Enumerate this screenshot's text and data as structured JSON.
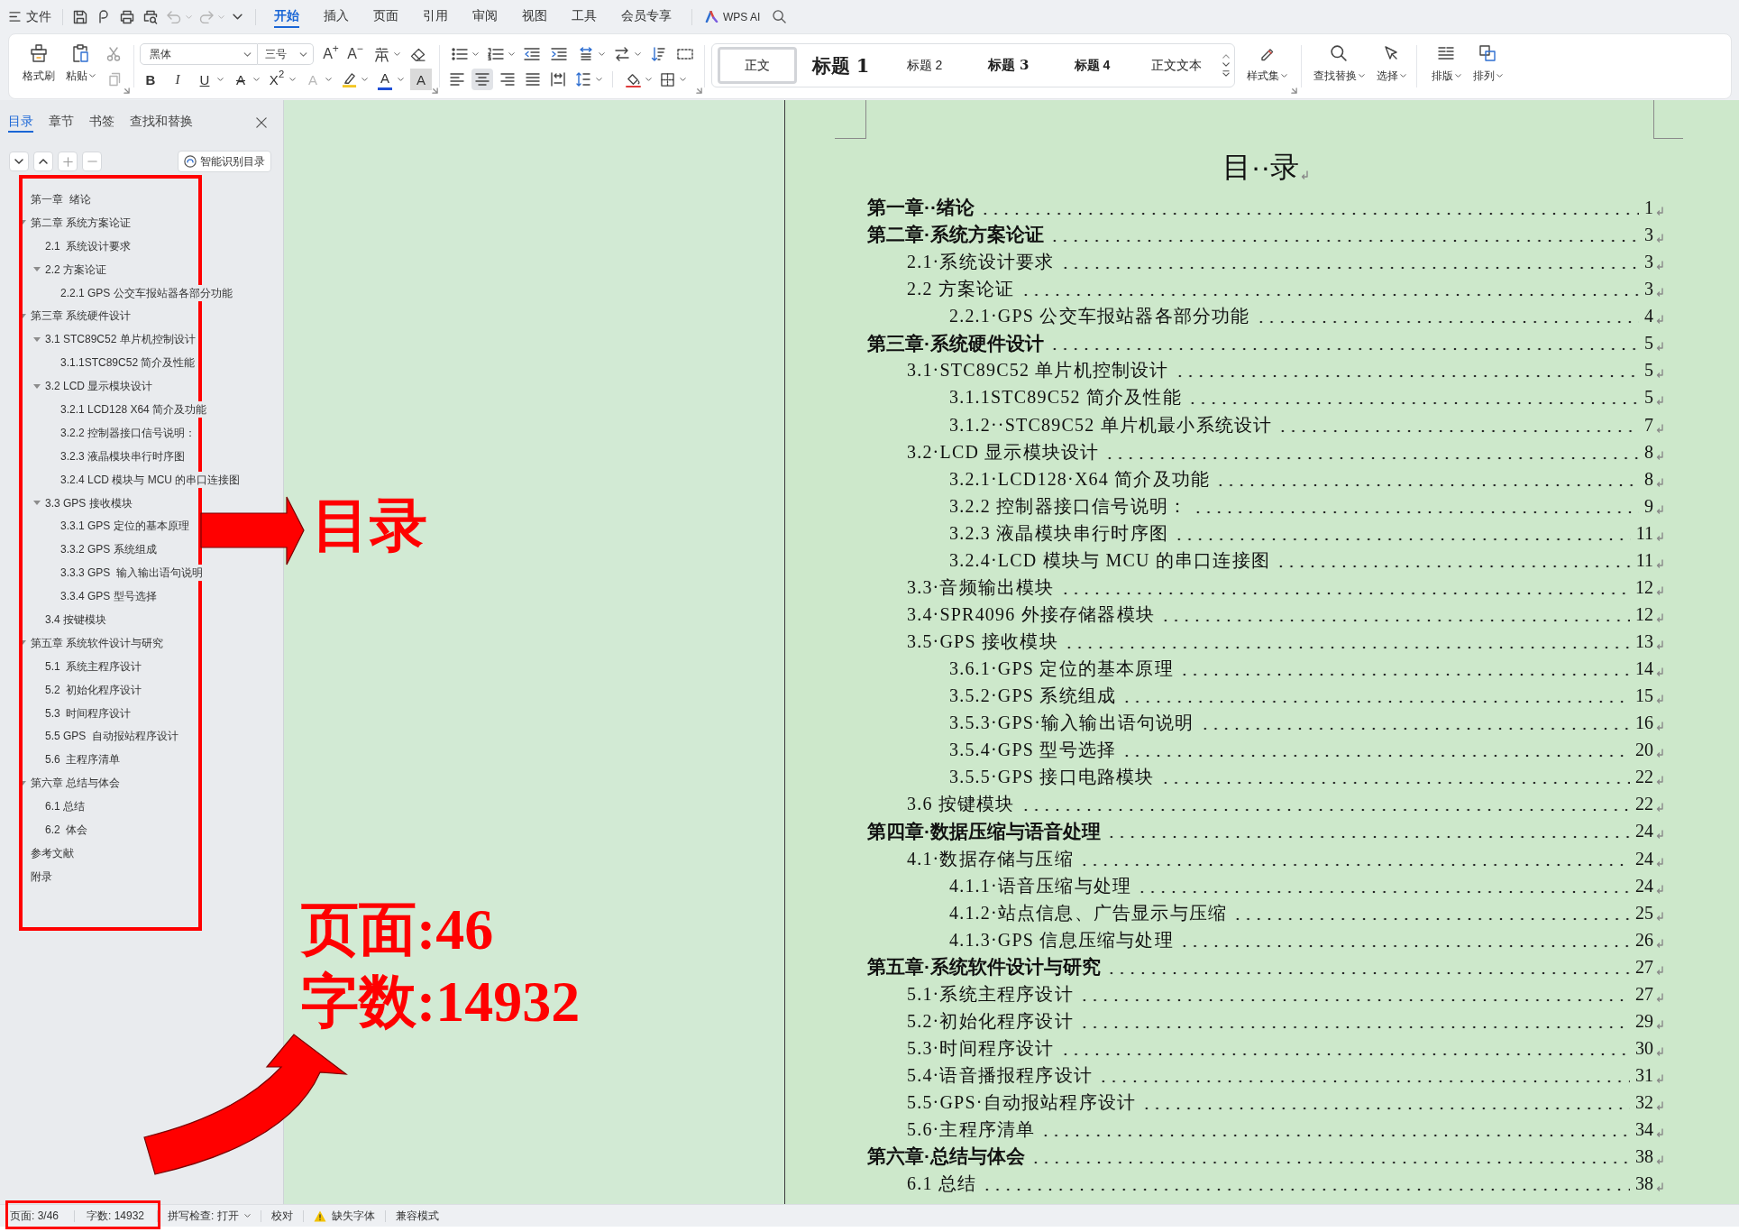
{
  "menu_bar": {
    "file_menu": "文件",
    "tabs": [
      {
        "label": "开始",
        "selected": true
      },
      {
        "label": "插入",
        "selected": false
      },
      {
        "label": "页面",
        "selected": false
      },
      {
        "label": "引用",
        "selected": false
      },
      {
        "label": "审阅",
        "selected": false
      },
      {
        "label": "视图",
        "selected": false
      },
      {
        "label": "工具",
        "selected": false
      },
      {
        "label": "会员专享",
        "selected": false
      }
    ],
    "ai_button": "WPS AI"
  },
  "ribbon": {
    "format_painter": "格式刷",
    "paste": "粘贴",
    "font_name": "黑体",
    "font_size": "三号",
    "size_buttons": [
      "A$^{+}$",
      "A$^{−}$"
    ],
    "format_buttons": [
      {
        "kind": "bold",
        "label": "B"
      },
      {
        "kind": "italic",
        "label": "I"
      },
      {
        "kind": "underline",
        "label": "U"
      },
      {
        "kind": "strikethrough",
        "label": "A"
      },
      {
        "kind": "superscript",
        "label": "X$^{2}$"
      },
      {
        "kind": "effect",
        "label": "A"
      },
      {
        "kind": "color",
        "label": "A"
      },
      {
        "kind": "shading",
        "label": "A"
      }
    ],
    "alignment": [
      {
        "kind": "left",
        "selected": false
      },
      {
        "kind": "center",
        "selected": true
      },
      {
        "kind": "right",
        "selected": false
      },
      {
        "kind": "justify",
        "selected": false
      },
      {
        "kind": "distributed",
        "selected": false
      }
    ],
    "styles": [
      {
        "kind": "body",
        "label": "正文",
        "selected": true
      },
      {
        "kind": "heading1",
        "label": "标题 1",
        "selected": false
      },
      {
        "kind": "heading2",
        "label": "标题 2",
        "selected": false
      },
      {
        "kind": "heading3",
        "label": "标题 3",
        "selected": false
      },
      {
        "kind": "heading4",
        "label": "标题 4",
        "selected": false
      },
      {
        "kind": "body_text",
        "label": "正文文本",
        "selected": false
      }
    ],
    "style_set": "样式集",
    "find_replace": "查找替换",
    "select": "选择",
    "layout": "排版",
    "arrange": "排列"
  },
  "sidebar": {
    "tabs": [
      {
        "label": "目录",
        "selected": true
      },
      {
        "label": "章节",
        "selected": false
      },
      {
        "label": "书签",
        "selected": false
      },
      {
        "label": "查找和替换",
        "selected": false
      }
    ],
    "smart_toc_button": "智能识别目录",
    "outline": [
      {
        "text": "第一章  绪论"
      },
      {
        "text": "第二章 系统方案论证",
        "expanded": true,
        "children": [
          {
            "text": "2.1  系统设计要求"
          },
          {
            "text": "2.2 方案论证",
            "expanded": true,
            "children": [
              {
                "text": "2.2.1 GPS 公交车报站器各部分功能"
              }
            ]
          }
        ]
      },
      {
        "text": "第三章 系统硬件设计",
        "expanded": true,
        "children": [
          {
            "text": "3.1 STC89C52 单片机控制设计",
            "expanded": true,
            "children": [
              {
                "text": "3.1.1STC89C52 简介及性能"
              }
            ]
          },
          {
            "text": "3.2 LCD 显示模块设计",
            "expanded": true,
            "children": [
              {
                "text": "3.2.1 LCD128 X64 简介及功能"
              },
              {
                "text": "3.2.2 控制器接口信号说明："
              },
              {
                "text": "3.2.3 液晶模块串行时序图"
              },
              {
                "text": "3.2.4 LCD 模块与 MCU 的串口连接图"
              }
            ]
          },
          {
            "text": "3.3 GPS 接收模块",
            "expanded": true,
            "children": [
              {
                "text": "3.3.1 GPS 定位的基本原理"
              },
              {
                "text": "3.3.2 GPS 系统组成"
              },
              {
                "text": "3.3.3 GPS  输入输出语句说明"
              },
              {
                "text": "3.3.4 GPS 型号选择"
              }
            ]
          },
          {
            "text": "3.4 按键模块"
          }
        ]
      },
      {
        "text": "第五章 系统软件设计与研究",
        "expanded": true,
        "children": [
          {
            "text": "5.1  系统主程序设计"
          },
          {
            "text": "5.2  初始化程序设计"
          },
          {
            "text": "5.3  时间程序设计"
          },
          {
            "text": "5.5 GPS  自动报站程序设计"
          },
          {
            "text": "5.6  主程序清单"
          }
        ]
      },
      {
        "text": "第六章 总结与体会",
        "expanded": true,
        "children": [
          {
            "text": "6.1 总结"
          },
          {
            "text": "6.2  体会"
          }
        ]
      },
      {
        "text": "参考文献"
      },
      {
        "text": "附录"
      }
    ]
  },
  "document": {
    "title": "目··录",
    "toc": [
      {
        "text": "第一章··绪论",
        "page": "1"
      },
      {
        "text": "第二章·系统方案论证",
        "page": "3",
        "children": [
          {
            "text": "2.1·系统设计要求",
            "page": "3"
          },
          {
            "text": "2.2 方案论证",
            "page": "3",
            "children": [
              {
                "text": "2.2.1·GPS 公交车报站器各部分功能",
                "page": "4"
              }
            ]
          }
        ]
      },
      {
        "text": "第三章·系统硬件设计",
        "page": "5",
        "children": [
          {
            "text": "3.1·STC89C52 单片机控制设计",
            "page": "5",
            "children": [
              {
                "text": "3.1.1STC89C52 简介及性能",
                "page": "5"
              },
              {
                "text": "3.1.2··STC89C52 单片机最小系统设计",
                "page": "7"
              }
            ]
          },
          {
            "text": "3.2·LCD 显示模块设计",
            "page": "8",
            "children": [
              {
                "text": "3.2.1·LCD128·X64 简介及功能",
                "page": "8"
              },
              {
                "text": "3.2.2 控制器接口信号说明：",
                "page": "9"
              },
              {
                "text": "3.2.3 液晶模块串行时序图",
                "page": "11"
              },
              {
                "text": "3.2.4·LCD 模块与 MCU 的串口连接图",
                "page": "11"
              }
            ]
          },
          {
            "text": "3.3·音频输出模块",
            "page": "12"
          },
          {
            "text": "3.4·SPR4096 外接存储器模块",
            "page": "12"
          },
          {
            "text": "3.5·GPS 接收模块",
            "page": "13",
            "children": [
              {
                "text": "3.6.1·GPS 定位的基本原理",
                "page": "14"
              },
              {
                "text": "3.5.2·GPS 系统组成",
                "page": "15"
              },
              {
                "text": "3.5.3·GPS·输入输出语句说明",
                "page": "16"
              },
              {
                "text": "3.5.4·GPS 型号选择",
                "page": "20"
              },
              {
                "text": "3.5.5·GPS 接口电路模块",
                "page": "22"
              }
            ]
          },
          {
            "text": "3.6 按键模块",
            "page": "22"
          }
        ]
      },
      {
        "text": "第四章·数据压缩与语音处理",
        "page": "24",
        "children": [
          {
            "text": "4.1·数据存储与压缩",
            "page": "24",
            "children": [
              {
                "text": "4.1.1·语音压缩与处理",
                "page": "24"
              },
              {
                "text": "4.1.2·站点信息、广告显示与压缩",
                "page": "25"
              },
              {
                "text": "4.1.3·GPS 信息压缩与处理",
                "page": "26"
              }
            ]
          }
        ]
      },
      {
        "text": "第五章·系统软件设计与研究",
        "page": "27",
        "children": [
          {
            "text": "5.1·系统主程序设计",
            "page": "27"
          },
          {
            "text": "5.2·初始化程序设计",
            "page": "29"
          },
          {
            "text": "5.3·时间程序设计",
            "page": "30"
          },
          {
            "text": "5.4·语音播报程序设计",
            "page": "31"
          },
          {
            "text": "5.5·GPS·自动报站程序设计",
            "page": "32"
          },
          {
            "text": "5.6·主程序清单",
            "page": "34"
          }
        ]
      },
      {
        "text": "第六章·总结与体会",
        "page": "38",
        "children": [
          {
            "text": "6.1 总结",
            "page": "38"
          }
        ]
      }
    ]
  },
  "status_bar": {
    "items": [
      {
        "kind": "page_count",
        "label": "页面: 3/46"
      },
      {
        "kind": "word_count",
        "label": "字数: 14932"
      },
      {
        "kind": "dropdown",
        "label": "拼写检查: 打开"
      },
      {
        "kind": "button",
        "label": "校对"
      },
      {
        "kind": "warning",
        "label": "缺失字体"
      },
      {
        "kind": "button",
        "label": "兼容模式"
      }
    ]
  },
  "annotations": {
    "toc_label": "目录",
    "page_count": "页面:46",
    "word_count": "字数:14932"
  }
}
